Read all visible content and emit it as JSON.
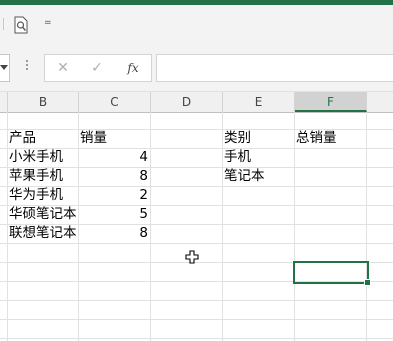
{
  "ribbon": {
    "customize_caret": "="
  },
  "formula_bar": {
    "cancel_symbol": "✕",
    "enter_symbol": "✓",
    "fx_label": "fx",
    "formula_value": ""
  },
  "columns": [
    "B",
    "C",
    "D",
    "E",
    "F"
  ],
  "selected_column": "F",
  "cells": {
    "B1": "产品",
    "C1": "销量",
    "E1": "类别",
    "F1": "总销量",
    "B2": "小米手机",
    "C2": "4",
    "E2": "手机",
    "B3": "苹果手机",
    "C3": "8",
    "E3": "笔记本",
    "B4": "华为手机",
    "C4": "2",
    "B5": "华硕笔记本",
    "C5": "5",
    "B6": "联想笔记本",
    "C6": "8"
  },
  "accent_color": "#217346"
}
